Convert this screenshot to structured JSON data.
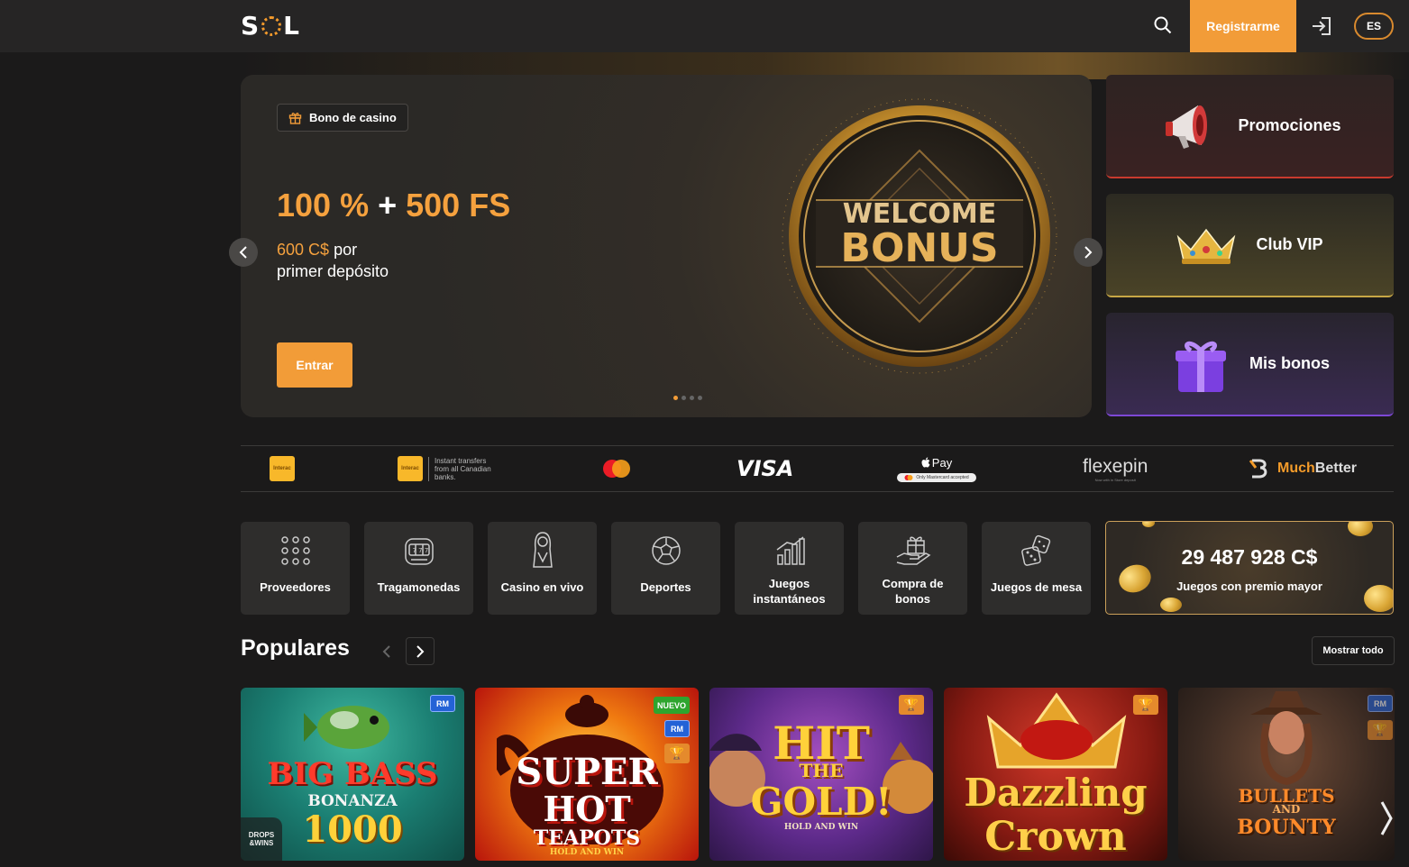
{
  "header": {
    "logo_left": "S",
    "logo_right": "L",
    "register_label": "Registrarme",
    "language": "ES"
  },
  "hero": {
    "badge": "Bono de casino",
    "title_percent": "100 %",
    "title_plus": "+",
    "title_fs": "500 FS",
    "sub_amount": "600 C$",
    "sub_rest": "por",
    "sub_line2": "primer depósito",
    "cta": "Entrar",
    "art_line1": "WELCOME",
    "art_line2": "BONUS",
    "slides": 4,
    "active_slide": 1
  },
  "side_cards": [
    {
      "label": "Promociones"
    },
    {
      "label": "Club VIP"
    },
    {
      "label": "Mis bonos"
    }
  ],
  "payments": {
    "interac": "Interac",
    "interac_note": "Instant transfers from all Canadian banks.",
    "visa": "VISA",
    "apple_pay": "Pay",
    "apple_note": "Only Mastercard accepted",
    "flexepin": "flexepin",
    "flexepin_note": "Now with in Store deposit",
    "much": "Much",
    "better": "Better"
  },
  "categories": [
    {
      "label": "Proveedores",
      "icon": "grid-dots-icon"
    },
    {
      "label": "Tragamonedas",
      "icon": "slot-machine-icon"
    },
    {
      "label": "Casino en vivo",
      "icon": "live-dealer-icon"
    },
    {
      "label": "Deportes",
      "icon": "soccer-ball-icon"
    },
    {
      "label": "Juegos instantáneos",
      "icon": "bar-chart-icon"
    },
    {
      "label": "Compra de bonos",
      "icon": "gift-hand-icon"
    },
    {
      "label": "Juegos de mesa",
      "icon": "dice-icon"
    }
  ],
  "jackpot": {
    "amount": "29 487 928 C$",
    "label": "Juegos con premio mayor"
  },
  "popular": {
    "title": "Populares",
    "show_all": "Mostrar todo",
    "games": [
      {
        "l1": "BIG BASS",
        "l2": "BONANZA",
        "l3": "1000",
        "tag_drops_1": "DROPS",
        "tag_drops_2": "&WINS"
      },
      {
        "l1": "SUPER",
        "l2": "HOT",
        "l3": "TEAPOTS",
        "l4": "HOLD AND WIN",
        "tag_new": "NUEVO"
      },
      {
        "l1": "HIT",
        "l2": "THE",
        "l3": "GOLD!",
        "l4": "HOLD AND WIN"
      },
      {
        "l1": "Dazzling",
        "l2": "Crown"
      },
      {
        "l1": "BULLETS",
        "l2": "AND",
        "l3": "BOUNTY"
      }
    ],
    "tag_rm": "RM"
  },
  "colors": {
    "accent": "#f29c38",
    "background": "#1b1a1a",
    "topbar": "#262525",
    "promo_accent": "#c93a2e",
    "vip_accent": "#c6a645",
    "bonus_accent": "#7e48d6"
  }
}
